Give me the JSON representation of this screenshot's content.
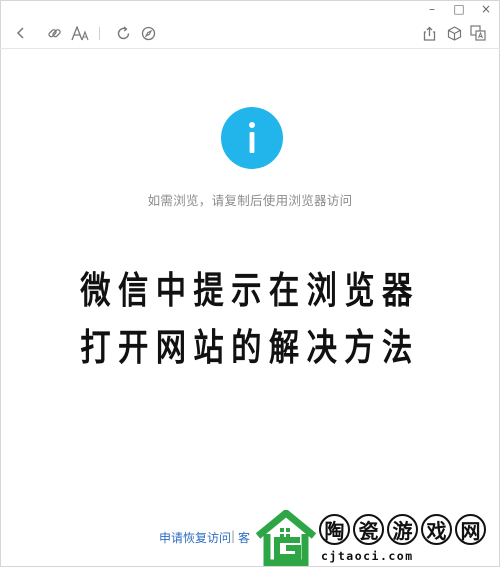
{
  "window": {
    "controls": [
      "–",
      "□",
      "×"
    ]
  },
  "toolbar": {
    "back_icon": "back-icon",
    "link_icon": "link-icon",
    "font_icon": "font-size-icon",
    "refresh_icon": "refresh-icon",
    "compass_icon": "compass-icon",
    "share_icon": "share-icon",
    "cube_icon": "cube-icon",
    "translate_icon": "translate-icon"
  },
  "main": {
    "info_text": "如需浏览，请复制后使用浏览器访问",
    "headline_line1": "微信中提示在浏览器",
    "headline_line2": "打开网站的解决方法"
  },
  "footer": {
    "link_text": "申请恢复访问",
    "separator": "|",
    "truncated_text": "客"
  },
  "watermark": {
    "chars": [
      "陶",
      "瓷",
      "游",
      "戏",
      "网"
    ],
    "url": "cjtaoci.com"
  },
  "colors": {
    "accent": "#22b5ec",
    "link": "#2f6ec0",
    "watermark_green": "#2ea646"
  }
}
